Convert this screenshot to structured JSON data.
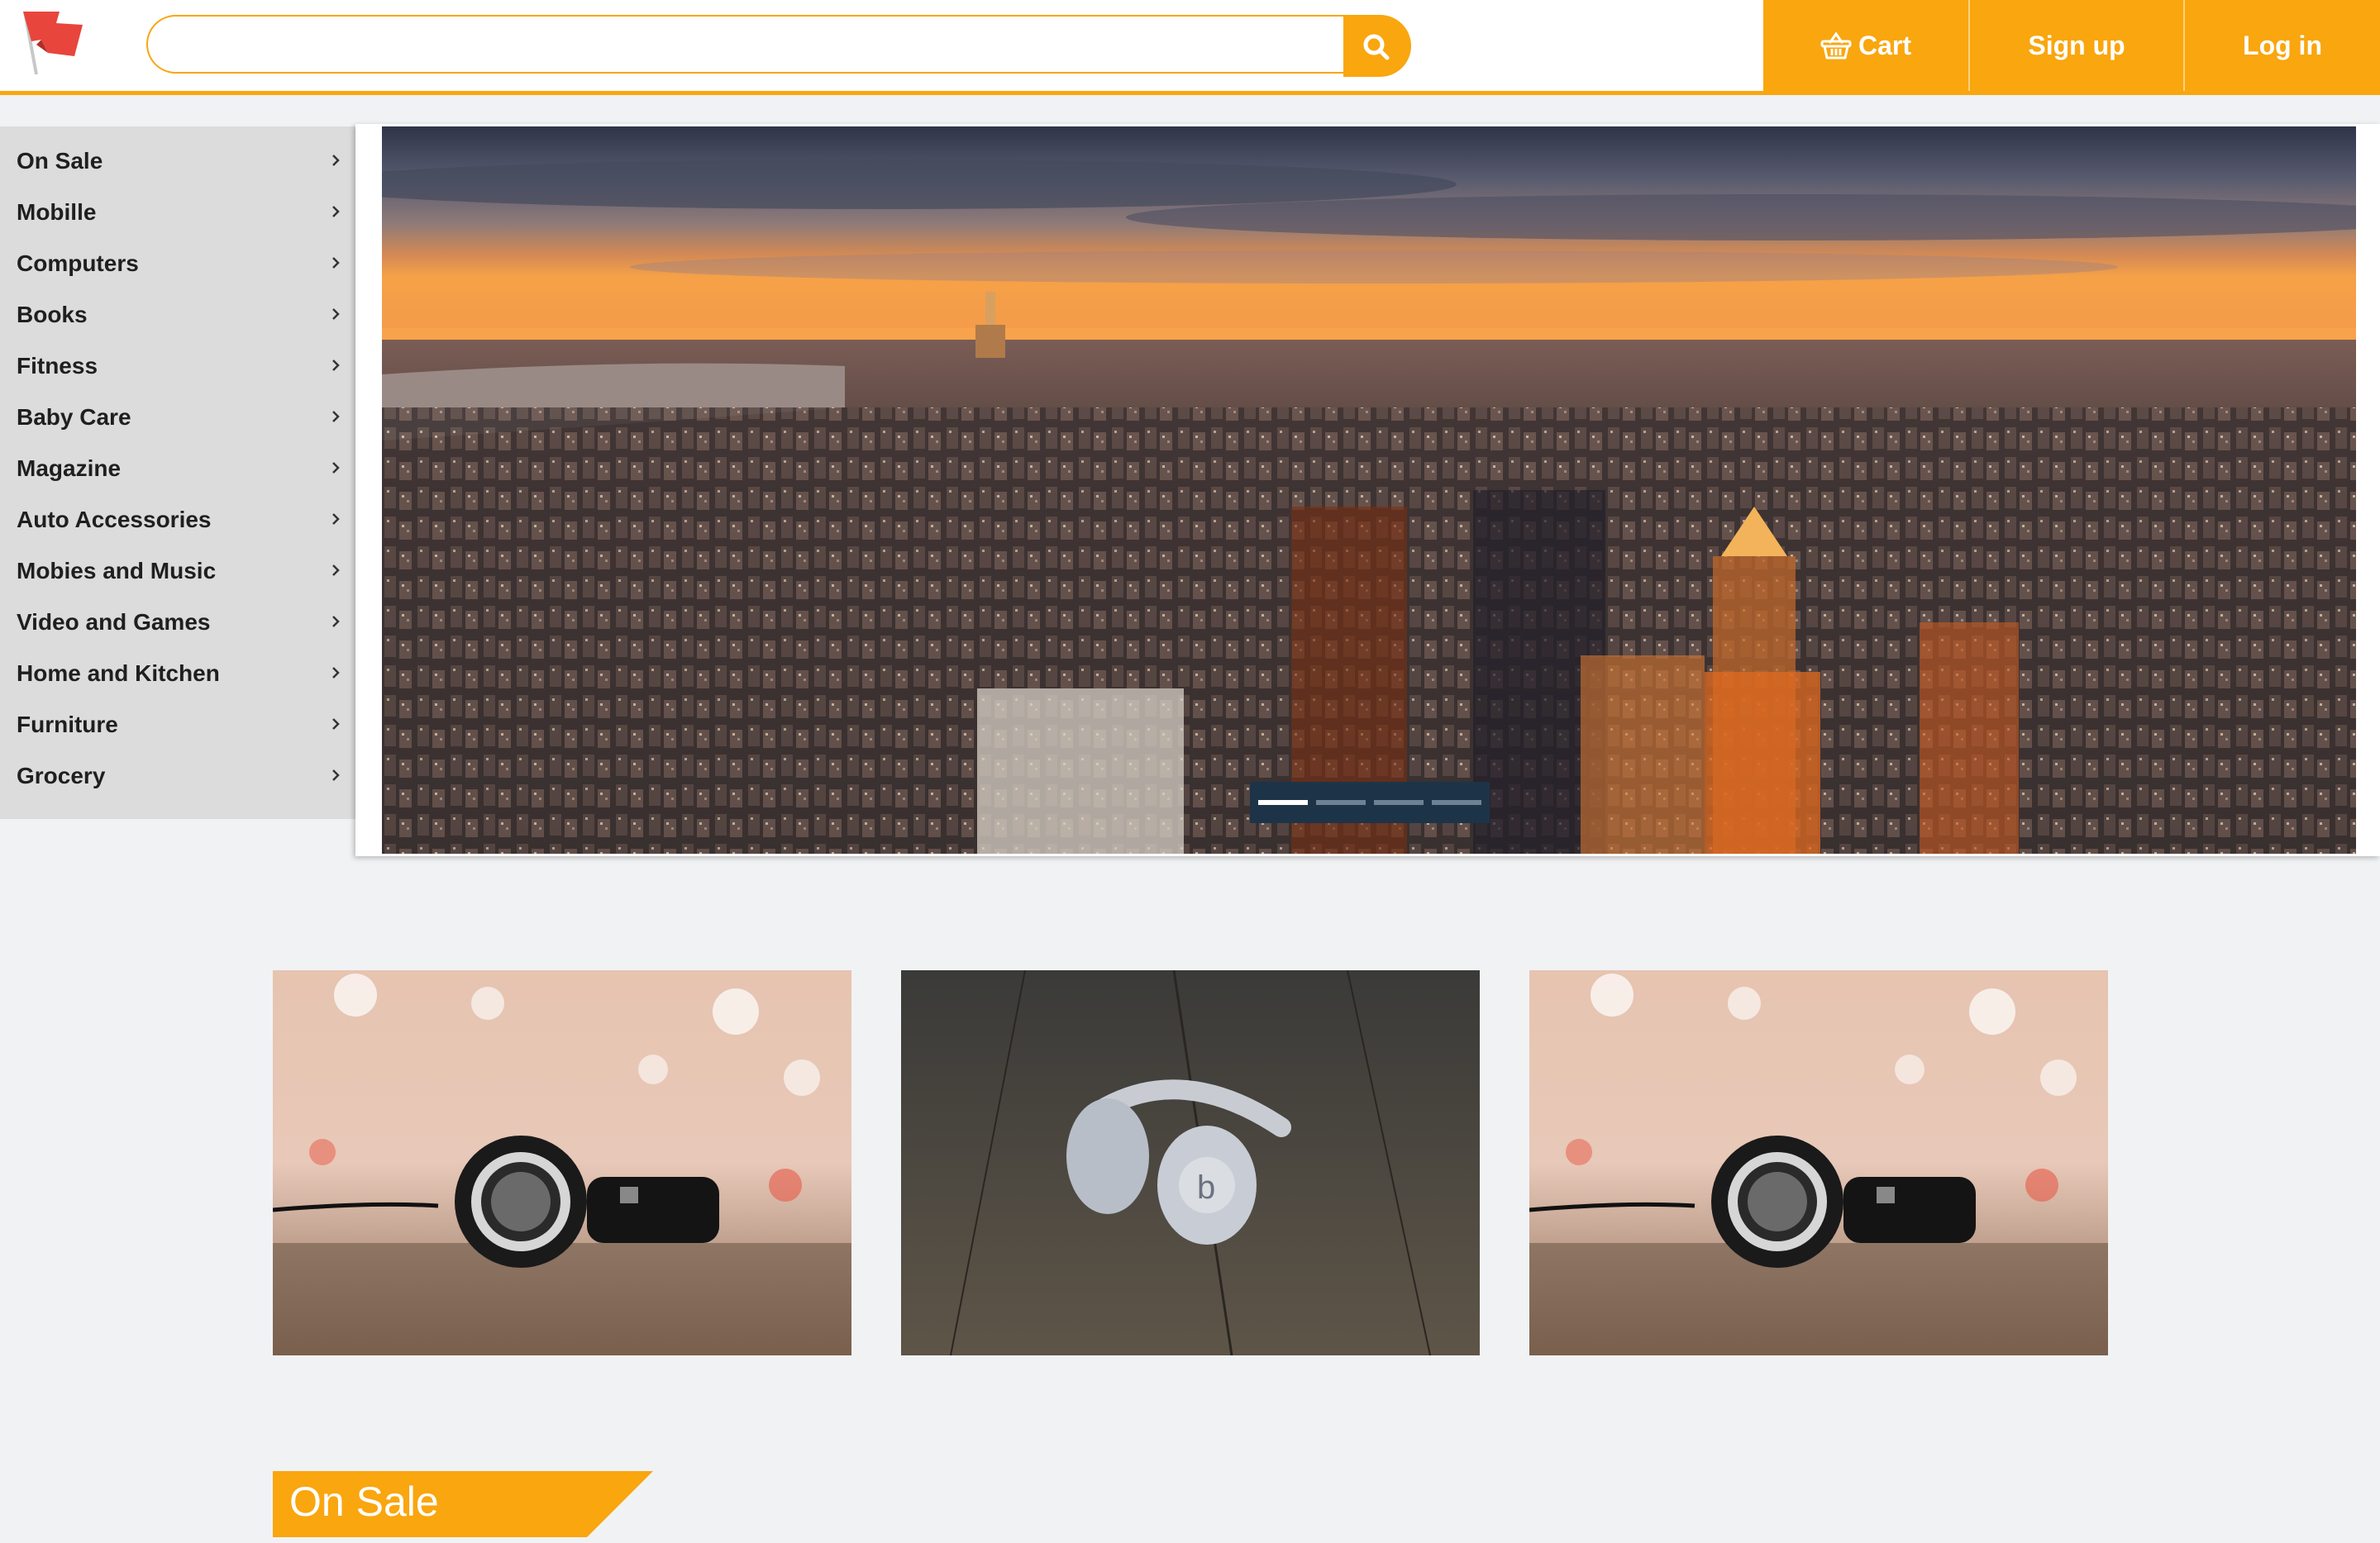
{
  "header": {
    "logo": "red-flag-logo",
    "search": {
      "value": "",
      "placeholder": "",
      "button_icon": "search-icon"
    },
    "nav": {
      "cart_label": "Cart",
      "cart_icon": "basket-icon",
      "signup_label": "Sign up",
      "login_label": "Log in"
    }
  },
  "sidebar": {
    "items": [
      {
        "label": "On Sale"
      },
      {
        "label": "Mobille"
      },
      {
        "label": "Computers"
      },
      {
        "label": "Books"
      },
      {
        "label": "Fitness"
      },
      {
        "label": "Baby Care"
      },
      {
        "label": "Magazine"
      },
      {
        "label": "Auto Accessories"
      },
      {
        "label": "Mobies and Music"
      },
      {
        "label": "Video and Games"
      },
      {
        "label": "Home and Kitchen"
      },
      {
        "label": "Furniture"
      },
      {
        "label": "Grocery"
      }
    ]
  },
  "carousel": {
    "slide_count": 4,
    "active_index": 0
  },
  "product_tiles": [
    {
      "image": "black-headphones-bokeh"
    },
    {
      "image": "white-headphones-wood"
    },
    {
      "image": "black-headphones-bokeh"
    }
  ],
  "section": {
    "title": "On Sale"
  },
  "colors": {
    "accent": "#f9a60f",
    "sidebar_bg": "#dcdcdc",
    "page_bg": "#f1f2f4",
    "carousel_indicator_bg": "#1d3448"
  }
}
